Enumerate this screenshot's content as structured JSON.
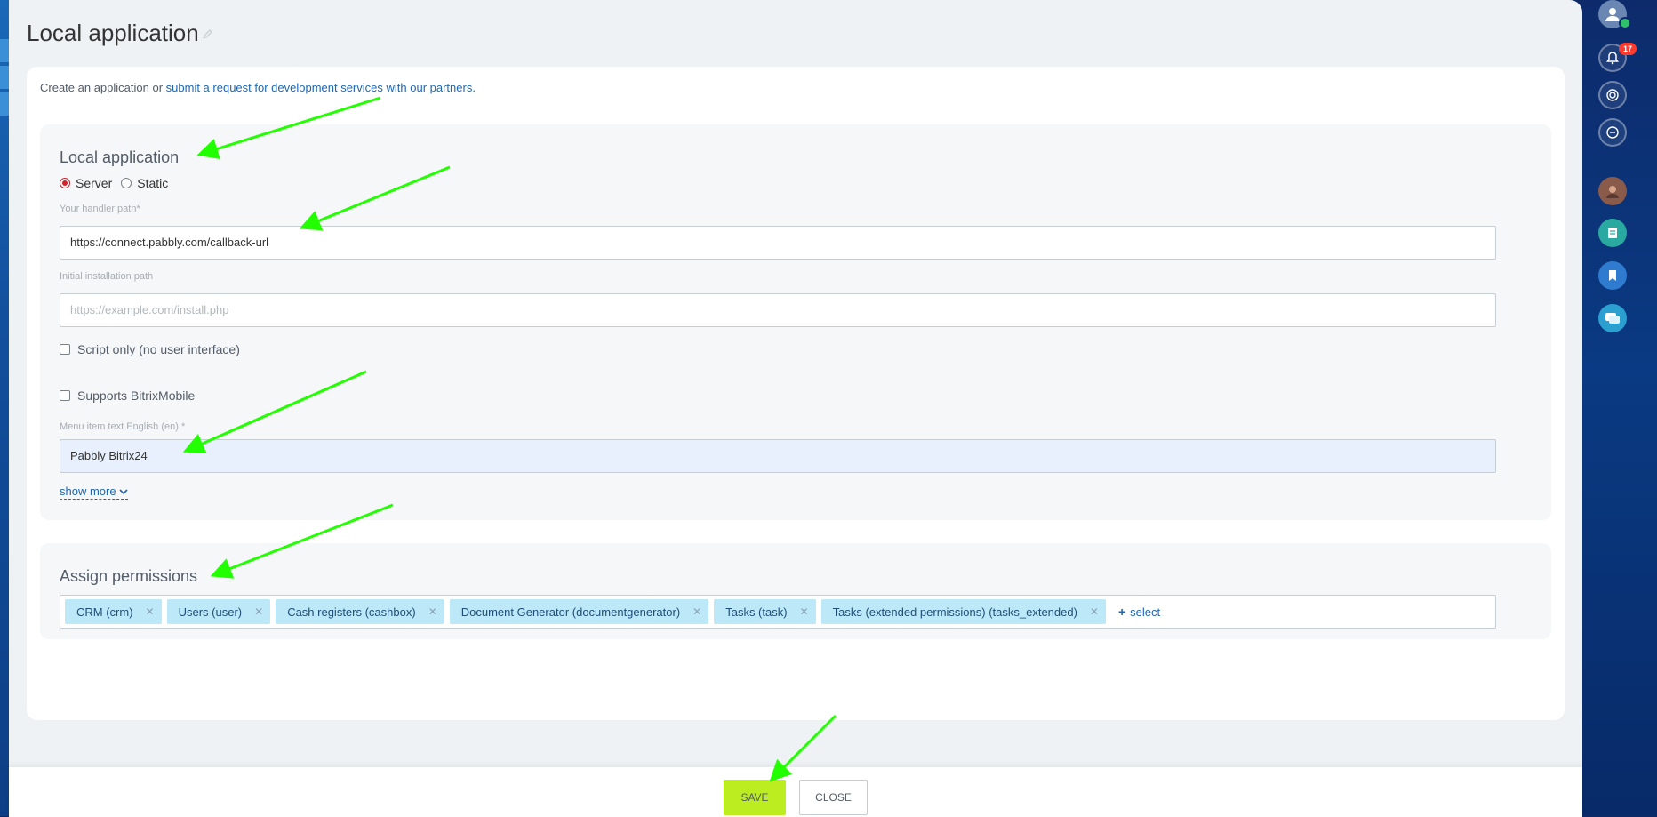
{
  "page": {
    "title": "Local application",
    "intro_prefix": "Create an application or ",
    "intro_link": "submit a request for development services",
    "intro_suffix": " with our partners."
  },
  "app_section": {
    "title": "Local application",
    "type_options": [
      {
        "label": "Server",
        "checked": true
      },
      {
        "label": "Static",
        "checked": false
      }
    ],
    "handler_label": "Your handler path*",
    "handler_value": "https://connect.pabbly.com/callback-url",
    "install_label": "Initial installation path",
    "install_placeholder": "https://example.com/install.php",
    "script_only_label": "Script only (no user interface)",
    "bitrix_mobile_label": "Supports BitrixMobile",
    "menu_label": "Menu item text English (en) *",
    "menu_value": "Pabbly Bitrix24",
    "show_more": "show more"
  },
  "permissions": {
    "title": "Assign permissions",
    "tags": [
      "CRM (crm)",
      "Users (user)",
      "Cash registers (cashbox)",
      "Document Generator (documentgenerator)",
      "Tasks (task)",
      "Tasks (extended permissions) (tasks_extended)"
    ],
    "select_label": "select"
  },
  "footer": {
    "save": "SAVE",
    "close": "CLOSE"
  },
  "right_bar": {
    "notification_count": "17",
    "icons": [
      "user-avatar-icon",
      "bell-icon",
      "copilot-icon",
      "search-chat-icon",
      "contact-avatar-icon",
      "notes-icon",
      "bookmark-icon",
      "chat-icon"
    ]
  },
  "colors": {
    "accent_link": "#2067b0",
    "save_button": "#bbed21",
    "tag_bg": "#bce8f8",
    "annotation_arrow": "#22ff00"
  }
}
